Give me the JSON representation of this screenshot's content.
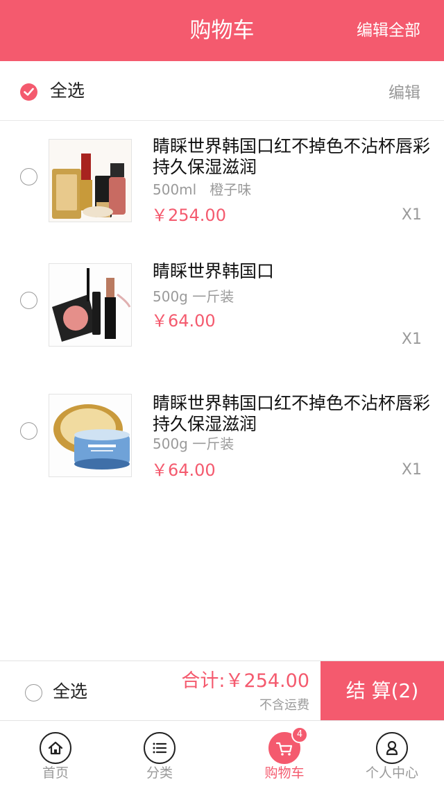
{
  "header": {
    "title": "购物车",
    "edit_all": "编辑全部"
  },
  "select_all_row": {
    "label": "全选",
    "edit": "编辑",
    "checked": true
  },
  "items": [
    {
      "name": "睛睬世界韩国口红不掉色不沾杯唇彩持久保湿滋润",
      "spec": "500ml   橙子味",
      "price": "￥254.00",
      "qty": "X1",
      "image_icon": "cosmetics-set-image"
    },
    {
      "name": "睛睬世界韩国口",
      "spec": "500g 一斤装",
      "price": "￥64.00",
      "qty": "X1",
      "image_icon": "lipstick-blush-image"
    },
    {
      "name": "睛睬世界韩国口红不掉色不沾杯唇彩持久保湿滋润",
      "spec": "500g 一斤装",
      "price": "￥64.00",
      "qty": "X1",
      "image_icon": "cream-jar-image"
    }
  ],
  "footer": {
    "select_all": "全选",
    "total": "合计:￥254.00",
    "shipping_note": "不含运费",
    "checkout": "结 算(2)"
  },
  "tabbar": {
    "tabs": [
      {
        "label": "首页",
        "icon": "home-icon"
      },
      {
        "label": "分类",
        "icon": "list-icon"
      },
      {
        "label": "购物车",
        "icon": "cart-icon",
        "badge": "4",
        "active": true
      },
      {
        "label": "个人中心",
        "icon": "user-icon"
      }
    ]
  },
  "colors": {
    "accent": "#f45a6e",
    "muted": "#9a9a9a"
  }
}
